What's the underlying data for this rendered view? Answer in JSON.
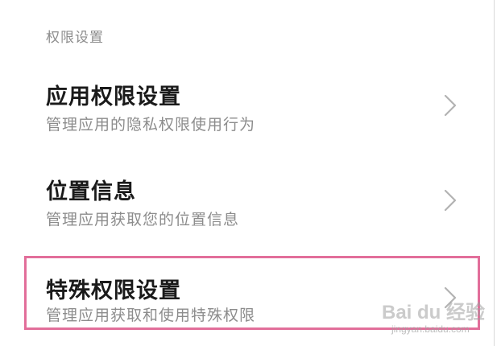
{
  "section": {
    "header": "权限设置"
  },
  "items": [
    {
      "title": "应用权限设置",
      "subtitle": "管理应用的隐私权限使用行为"
    },
    {
      "title": "位置信息",
      "subtitle": "管理应用获取您的位置信息"
    },
    {
      "title": "特殊权限设置",
      "subtitle": "管理应用获取和使用特殊权限"
    }
  ],
  "icons": {
    "chevron": "chevron-right-icon"
  },
  "colors": {
    "highlight_border": "#e26e9a",
    "title_text": "#1a1a1a",
    "subtitle_text": "#8c8c8c"
  },
  "watermark": {
    "logo": "Bai du 经验",
    "url": "jingyan.baidu.com"
  }
}
